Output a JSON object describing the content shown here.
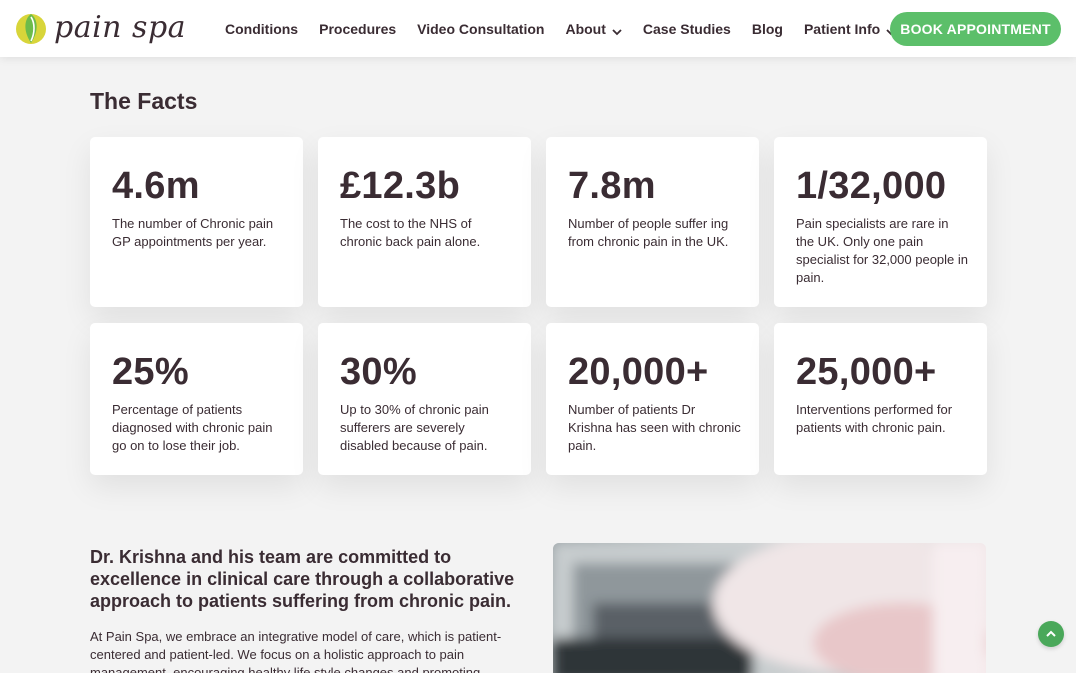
{
  "brand": {
    "name": "pain spa"
  },
  "nav": {
    "items": [
      {
        "label": "Conditions"
      },
      {
        "label": "Procedures"
      },
      {
        "label": "Video Consultation"
      },
      {
        "label": "About"
      },
      {
        "label": "Case Studies"
      },
      {
        "label": "Blog"
      },
      {
        "label": "Patient Info"
      }
    ],
    "cta": "BOOK APPOINTMENT"
  },
  "facts": {
    "title": "The Facts",
    "cards": [
      {
        "value": "4.6m",
        "text": "The number of Chronic pain GP appointments per year."
      },
      {
        "value": "£12.3b",
        "text": "The cost to the NHS of chronic back pain alone."
      },
      {
        "value": "7.8m",
        "text": "Number of people suffer ing from chronic pain in the UK."
      },
      {
        "value": "1/32,000",
        "text": "Pain specialists are rare in the UK. Only one pain specialist for 32,000 people in pain."
      },
      {
        "value": "25%",
        "text": "Percentage of patients diagnosed with chronic pain go on to lose their job."
      },
      {
        "value": "30%",
        "text": "Up to 30% of chronic pain sufferers are severely disabled because of pain."
      },
      {
        "value": "20,000+",
        "text": "Number of patients Dr Krishna has seen with chronic pain."
      },
      {
        "value": "25,000+",
        "text": "Interventions performed for patients with chronic pain."
      }
    ]
  },
  "about": {
    "heading": "Dr. Krishna and his team are committed to excellence in clinical care through a collaborative approach to patients suffering from chronic pain.",
    "body": "At Pain Spa, we embrace an integrative model of care, which is patient-centered and patient-led. We focus on a holistic approach to pain management, encouraging healthy life style changes and promoting"
  },
  "colors": {
    "accent": "#5cbf6a",
    "text": "#3a2c33",
    "logo_yellow": "#d8d53a",
    "logo_green": "#6dbb4a"
  },
  "icons": {
    "dropdown": "chevron-down-icon",
    "scroll_top": "chevron-up-icon"
  }
}
